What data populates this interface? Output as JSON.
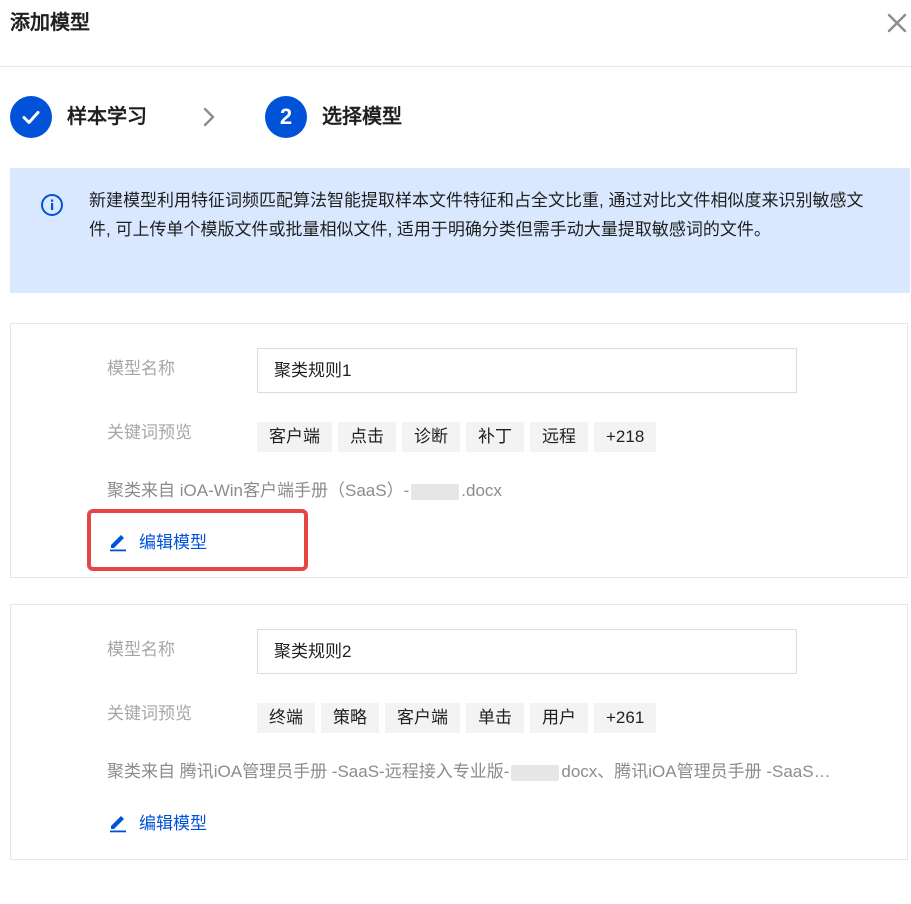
{
  "dialog": {
    "title": "添加模型",
    "close_icon": "close-icon"
  },
  "steps": [
    {
      "label": "样本学习",
      "state": "done",
      "icon": "check-icon"
    },
    {
      "label": "选择模型",
      "state": "active",
      "number": "2"
    }
  ],
  "alert": {
    "icon": "info-icon",
    "text": "新建模型利用特征词频匹配算法智能提取样本文件特征和占全文比重, 通过对比文件相似度来识别敏感文件, 可上传单个模版文件或批量相似文件, 适用于明确分类但需手动大量提取敏感词的文件。"
  },
  "models": [
    {
      "name_label": "模型名称",
      "name_value": "聚类规则1",
      "keywords_label": "关键词预览",
      "keywords": [
        "客户端",
        "点击",
        "诊断",
        "补丁",
        "远程",
        "+218"
      ],
      "source_label": "聚类来自",
      "source_part1": "iOA-Win客户端手册（SaaS）-",
      "source_part2": ".docx",
      "edit_label": "编辑模型"
    },
    {
      "name_label": "模型名称",
      "name_value": "聚类规则2",
      "keywords_label": "关键词预览",
      "keywords": [
        "终端",
        "策略",
        "客户端",
        "单击",
        "用户",
        "+261"
      ],
      "source_label": "聚类来自",
      "source_part1": "腾讯iOA管理员手册 -SaaS-远程接入专业版-",
      "source_part2": "docx、腾讯iOA管理员手册 -SaaS…",
      "edit_label": "编辑模型"
    }
  ],
  "colors": {
    "primary": "#0052d9",
    "alert_bg": "#d9e8ff",
    "highlight": "#e54545"
  }
}
